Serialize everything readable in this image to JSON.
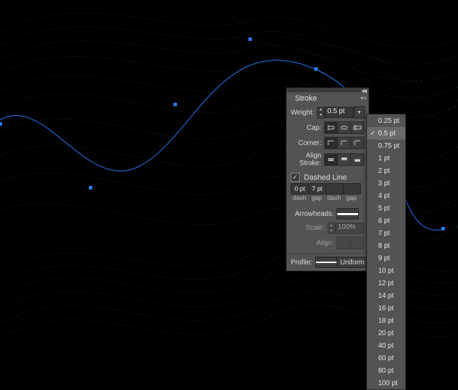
{
  "panel": {
    "title": "Stroke",
    "weight_label": "Weight:",
    "weight_value": "0.5 pt",
    "cap_label": "Cap:",
    "corner_label": "Corner:",
    "align_label": "Align Stroke:",
    "dashed_label": "Dashed Line",
    "dashed_checked": true,
    "dash_values": [
      "0 pt",
      "7 pt",
      "",
      "",
      ""
    ],
    "dash_sublabels": [
      "dash",
      "gap",
      "dash",
      "gap"
    ],
    "arrowheads_label": "Arrowheads:",
    "scale_label": "Scale:",
    "scale_value": "100%",
    "align_arrow_label": "Align:",
    "profile_label": "Profile:",
    "profile_value": "Uniform"
  },
  "weight_dropdown": {
    "selected": "0.5 pt",
    "options": [
      "0.25 pt",
      "0.5 pt",
      "0.75 pt",
      "1 pt",
      "2 pt",
      "3 pt",
      "4 pt",
      "5 pt",
      "6 pt",
      "7 pt",
      "8 pt",
      "9 pt",
      "10 pt",
      "12 pt",
      "14 pt",
      "16 pt",
      "18 pt",
      "20 pt",
      "40 pt",
      "60 pt",
      "80 pt",
      "100 pt"
    ]
  },
  "artwork": {
    "stroke_color": "#3fd7de",
    "anchor_color": "#2a7aff"
  }
}
